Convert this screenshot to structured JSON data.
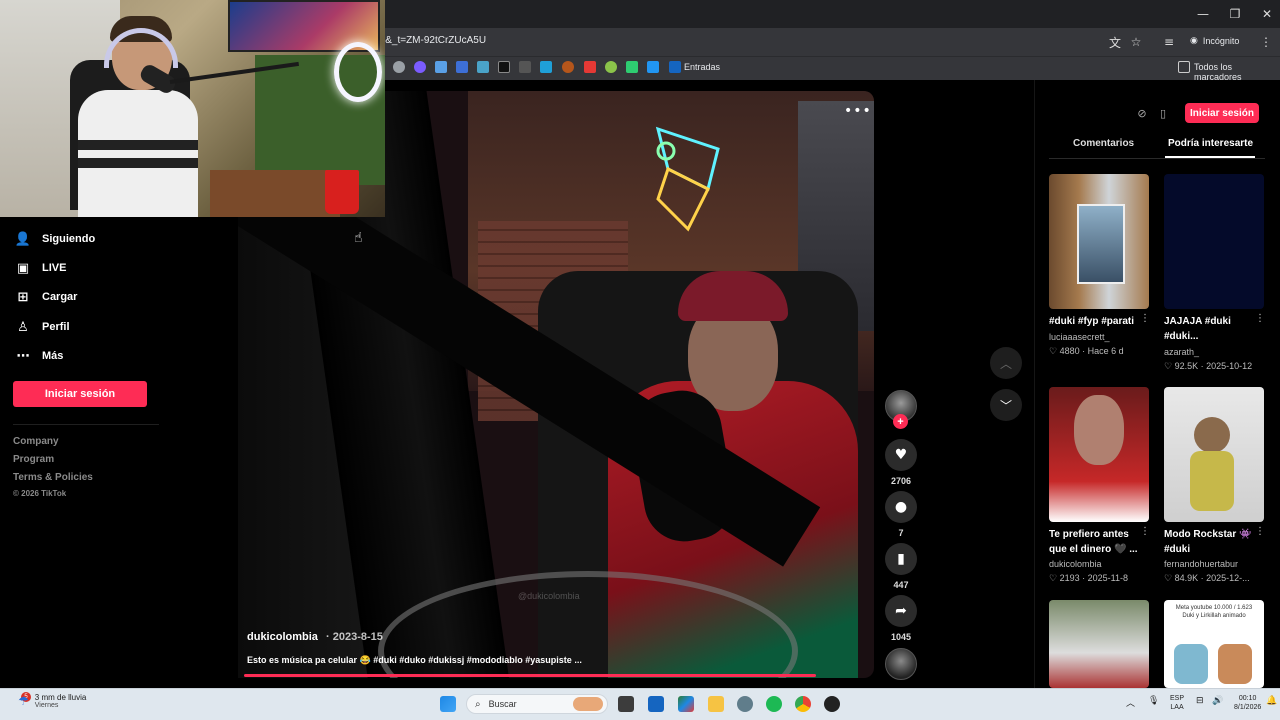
{
  "browser": {
    "url": "l&_t=ZM-92tCrZUcA5U",
    "incognito_label": "Incógnito",
    "bookmarks_label": "Entradas",
    "all_bookmarks_label": "Todos los marcadores"
  },
  "sidebar": {
    "items": [
      {
        "label": "Siguiendo",
        "icon": "following-icon"
      },
      {
        "label": "LIVE",
        "icon": "live-icon"
      },
      {
        "label": "Cargar",
        "icon": "upload-icon"
      },
      {
        "label": "Perfil",
        "icon": "profile-icon"
      },
      {
        "label": "Más",
        "icon": "more-icon"
      }
    ],
    "login_button": "Iniciar sesión",
    "links": [
      "Company",
      "Program",
      "Terms & Policies"
    ],
    "copyright": "© 2026 TikTok"
  },
  "video": {
    "author": "dukicolombia",
    "date": "· 2023-8-15",
    "description": "Esto es música pa celular 😂 #duki #duko #dukissj #mododiablo #yasupiste ...",
    "watermark": "@dukicolombia",
    "progress": 0.9
  },
  "actions": {
    "likes": "2706",
    "comments": "7",
    "saves": "447",
    "shares": "1045"
  },
  "right_panel": {
    "login_button": "Iniciar sesión",
    "tabs": [
      "Comentarios",
      "Podría interesarte"
    ],
    "cards": [
      {
        "title": "#duki #fyp #parati",
        "author": "luciaaasecrett_",
        "likes": "4880",
        "date": "Hace 6 d"
      },
      {
        "title": "JAJAJA #duki #duki...",
        "author": "azarath_",
        "likes": "92.5K",
        "date": "2025-10-12"
      },
      {
        "title": "Te prefiero antes que el dinero 🖤 ...",
        "author": "dukicolombia",
        "likes": "2193",
        "date": "2025-11-8"
      },
      {
        "title": "Modo Rockstar 👾 #duki",
        "author": "fernandohuertabur",
        "likes": "84.9K",
        "date": "2025-12-..."
      }
    ],
    "thumb5_text": "Meta youtube 10.000 / 1.623 Duki y Lirkillah animado"
  },
  "taskbar": {
    "weather": "3 mm de lluvia",
    "weather_day": "Viernes",
    "weather_badge": "5",
    "search_placeholder": "Buscar",
    "lang_1": "ESP",
    "lang_2": "LAA",
    "time": "00:10",
    "date": "8/1/2026"
  },
  "colors": {
    "accent": "#fe2c55",
    "background": "#000000"
  }
}
